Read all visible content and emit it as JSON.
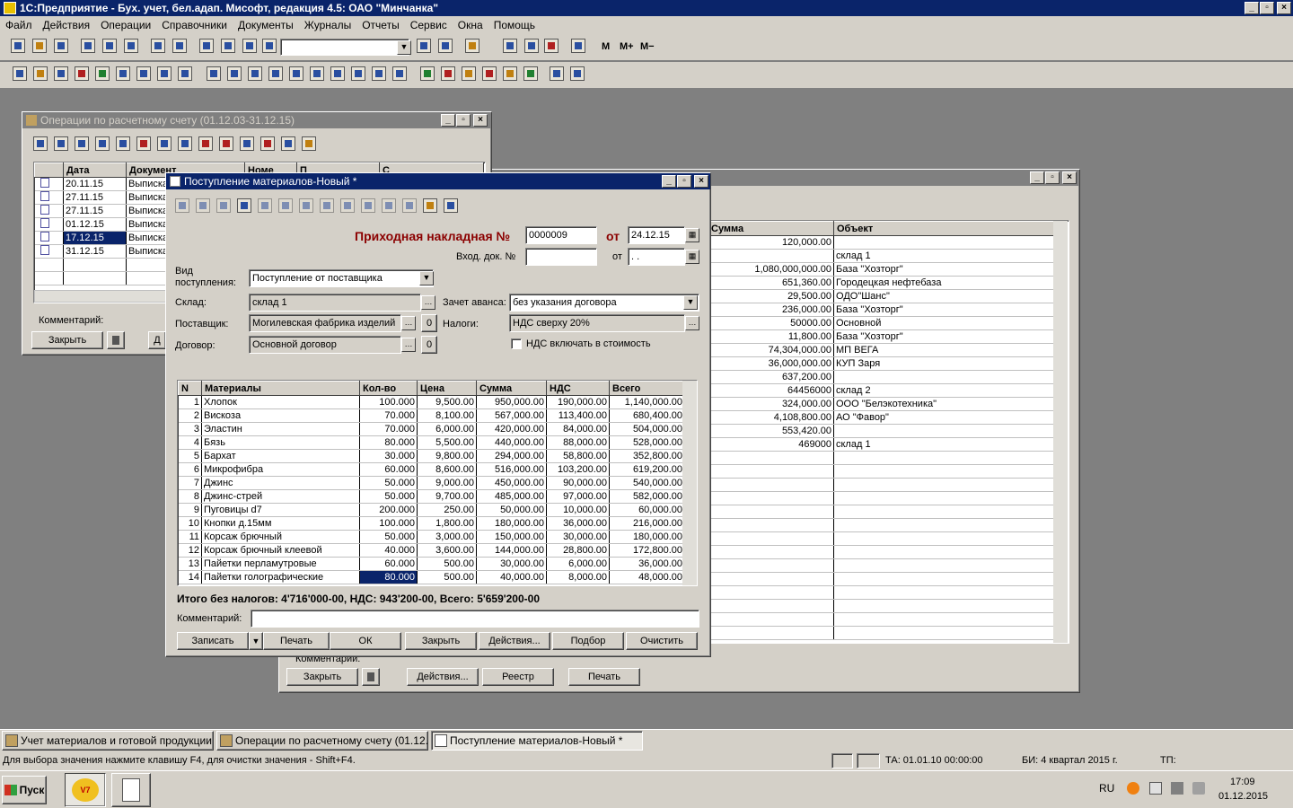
{
  "app": {
    "title": "1С:Предприятие - Бух. учет, бел.адап. Мисофт, редакция 4.5: ОАО \"Минчанка\""
  },
  "menu": [
    "Файл",
    "Действия",
    "Операции",
    "Справочники",
    "Документы",
    "Журналы",
    "Отчеты",
    "Сервис",
    "Окна",
    "Помощь"
  ],
  "toolbar": {
    "m1": "M",
    "m2": "M+",
    "m3": "M−"
  },
  "ops_window": {
    "title": "Операции по расчетному счету (01.12.03-31.12.15)",
    "columns": [
      "Дата",
      "Документ",
      "Номе",
      "П",
      "С"
    ],
    "rows": [
      {
        "date": "20.11.15",
        "doc": "Выписка"
      },
      {
        "date": "27.11.15",
        "doc": "Выписка"
      },
      {
        "date": "27.11.15",
        "doc": "Выписка"
      },
      {
        "date": "01.12.15",
        "doc": "Выписка"
      },
      {
        "date": "17.12.15",
        "doc": "Выписка"
      },
      {
        "date": "31.12.15",
        "doc": "Выписка"
      }
    ],
    "comment_label": "Комментарий:",
    "close_btn": "Закрыть",
    "a_btn": "Д"
  },
  "bg_window": {
    "columns": [
      "Сумма",
      "Объект"
    ],
    "rows": [
      {
        "sum": "120,000.00",
        "obj": ""
      },
      {
        "sum": "",
        "obj": "склад 1"
      },
      {
        "sum": "1,080,000,000.00",
        "obj": "База \"Хозторг\""
      },
      {
        "sum": "651,360.00",
        "obj": "Городецкая нефтебаза"
      },
      {
        "sum": "29,500.00",
        "obj": "ОДО\"Шанс\""
      },
      {
        "sum": "236,000.00",
        "obj": "База \"Хозторг\""
      },
      {
        "sum": "50000.00",
        "obj": "Основной"
      },
      {
        "sum": "11,800.00",
        "obj": "База \"Хозторг\""
      },
      {
        "sum": "74,304,000.00",
        "obj": "МП ВЕГА"
      },
      {
        "sum": "36,000,000.00",
        "obj": "КУП Заря"
      },
      {
        "sum": "637,200.00",
        "obj": ""
      },
      {
        "sum": "64456000",
        "obj": "склад 2"
      },
      {
        "sum": "324,000.00",
        "obj": "ООО \"Белэкотехника\""
      },
      {
        "sum": "4,108,800.00",
        "obj": "АО \"Фавор\""
      },
      {
        "sum": "553,420.00",
        "obj": ""
      },
      {
        "sum": "469000",
        "obj": "склад 1"
      }
    ],
    "comment_label": "Комментарий:",
    "close_btn": "Закрыть",
    "actions_btn": "Действия...",
    "registry_btn": "Реестр",
    "print_btn": "Печать"
  },
  "doc": {
    "title": "Поступление материалов-Новый *",
    "heading": "Приходная накладная №",
    "number": "0000009",
    "from_label": "от",
    "date": "24.12.15",
    "in_doc_label": "Вход. док. №",
    "in_doc": "",
    "from2_label": "от",
    "date2": " .  .",
    "kind_label": "Вид поступления:",
    "kind": "Поступление от поставщика",
    "warehouse_label": "Склад:",
    "warehouse": "склад 1",
    "advance_label": "Зачет аванса:",
    "advance": "без указания договора",
    "supplier_label": "Поставщик:",
    "supplier": "Могилевская фабрика изделий",
    "supplier_zero": "0",
    "taxes_label": "Налоги:",
    "taxes": "НДС сверху 20%",
    "contract_label": "Договор:",
    "contract": "Основной договор",
    "contract_zero": "0",
    "vat_check_label": "НДС включать в стоимость",
    "columns": [
      "N",
      "Материалы",
      "Кол-во",
      "Цена",
      "Сумма",
      "НДС",
      "Всего"
    ],
    "rows": [
      {
        "n": "1",
        "name": "Хлопок",
        "qty": "100.000",
        "price": "9,500.00",
        "sum": "950,000.00",
        "vat": "190,000.00",
        "total": "1,140,000.00"
      },
      {
        "n": "2",
        "name": "Вискоза",
        "qty": "70.000",
        "price": "8,100.00",
        "sum": "567,000.00",
        "vat": "113,400.00",
        "total": "680,400.00"
      },
      {
        "n": "3",
        "name": "Эластин",
        "qty": "70.000",
        "price": "6,000.00",
        "sum": "420,000.00",
        "vat": "84,000.00",
        "total": "504,000.00"
      },
      {
        "n": "4",
        "name": "Бязь",
        "qty": "80.000",
        "price": "5,500.00",
        "sum": "440,000.00",
        "vat": "88,000.00",
        "total": "528,000.00"
      },
      {
        "n": "5",
        "name": "Бархат",
        "qty": "30.000",
        "price": "9,800.00",
        "sum": "294,000.00",
        "vat": "58,800.00",
        "total": "352,800.00"
      },
      {
        "n": "6",
        "name": "Микрофибра",
        "qty": "60.000",
        "price": "8,600.00",
        "sum": "516,000.00",
        "vat": "103,200.00",
        "total": "619,200.00"
      },
      {
        "n": "7",
        "name": "Джинс",
        "qty": "50.000",
        "price": "9,000.00",
        "sum": "450,000.00",
        "vat": "90,000.00",
        "total": "540,000.00"
      },
      {
        "n": "8",
        "name": "Джинс-стрей",
        "qty": "50.000",
        "price": "9,700.00",
        "sum": "485,000.00",
        "vat": "97,000.00",
        "total": "582,000.00"
      },
      {
        "n": "9",
        "name": "Пуговицы d7",
        "qty": "200.000",
        "price": "250.00",
        "sum": "50,000.00",
        "vat": "10,000.00",
        "total": "60,000.00"
      },
      {
        "n": "10",
        "name": "Кнопки д.15мм",
        "qty": "100.000",
        "price": "1,800.00",
        "sum": "180,000.00",
        "vat": "36,000.00",
        "total": "216,000.00"
      },
      {
        "n": "11",
        "name": "Корсаж брючный",
        "qty": "50.000",
        "price": "3,000.00",
        "sum": "150,000.00",
        "vat": "30,000.00",
        "total": "180,000.00"
      },
      {
        "n": "12",
        "name": "Корсаж брючный клеевой",
        "qty": "40.000",
        "price": "3,600.00",
        "sum": "144,000.00",
        "vat": "28,800.00",
        "total": "172,800.00"
      },
      {
        "n": "13",
        "name": "Пайетки перламутровые",
        "qty": "60.000",
        "price": "500.00",
        "sum": "30,000.00",
        "vat": "6,000.00",
        "total": "36,000.00"
      },
      {
        "n": "14",
        "name": "Пайетки голографические",
        "qty": "80.000",
        "price": "500.00",
        "sum": "40,000.00",
        "vat": "8,000.00",
        "total": "48,000.00"
      }
    ],
    "totals": "Итого без налогов: 4'716'000-00, НДС: 943'200-00, Всего: 5'659'200-00",
    "comment_label": "Комментарий:",
    "comment": "",
    "buttons": {
      "save": "Записать",
      "print": "Печать",
      "ok": "ОК",
      "close": "Закрыть",
      "actions": "Действия...",
      "select": "Подбор",
      "clear": "Очистить"
    }
  },
  "taskbar": {
    "items": [
      "Учет материалов и готовой продукции ...",
      "Операции по расчетному счету (01.12....",
      "Поступление материалов-Новый *"
    ]
  },
  "status": {
    "hint": "Для выбора значения нажмите клавишу F4, для очистки значения - Shift+F4.",
    "ta": "ТА: 01.01.10  00:00:00",
    "bi": "БИ: 4 квартал 2015 г.",
    "tp": "ТП:"
  },
  "os": {
    "start": "Пуск",
    "lang": "RU",
    "time": "17:09",
    "date": "01.12.2015",
    "app_icon_label": "V7"
  }
}
